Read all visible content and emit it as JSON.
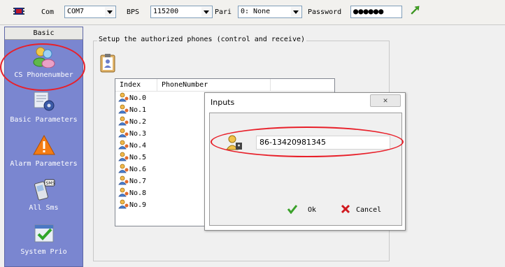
{
  "toolbar": {
    "com_label": "Com",
    "com_value": "COM7",
    "bps_label": "BPS",
    "bps_value": "115200",
    "parity_label": "Pari",
    "parity_value": "0: None",
    "password_label": "Password",
    "password_value": "●●●●●●"
  },
  "sidebar": {
    "header": "Basic",
    "items": [
      {
        "label": "CS Phonenumber"
      },
      {
        "label": "Basic Parameters"
      },
      {
        "label": "Alarm Parameters"
      },
      {
        "label": "All Sms"
      },
      {
        "label": "System Prio"
      }
    ]
  },
  "main": {
    "group_title": "Setup the authorized phones (control and receive)",
    "list": {
      "columns": [
        "Index",
        "PhoneNumber"
      ],
      "rows": [
        "No.0",
        "No.1",
        "No.2",
        "No.3",
        "No.4",
        "No.5",
        "No.6",
        "No.7",
        "No.8",
        "No.9"
      ]
    }
  },
  "dialog": {
    "title": "Inputs",
    "close_symbol": "✕",
    "input_value": "86-13420981345",
    "ok_label": "Ok",
    "cancel_label": "Cancel"
  },
  "colors": {
    "sidebar_bg": "#7a86d0",
    "annotation_red": "#e8202a"
  },
  "icons": [
    "chip-icon",
    "refresh-icon",
    "users-icon",
    "gear-icon",
    "warning-icon",
    "sms-icon",
    "checkmark-icon",
    "clipboard-user-icon",
    "user-icon",
    "key-user-icon",
    "ok-check-icon",
    "cancel-x-icon"
  ]
}
